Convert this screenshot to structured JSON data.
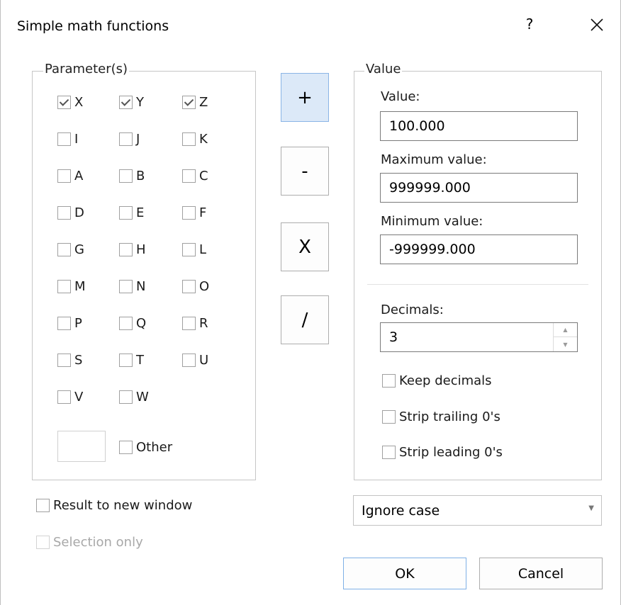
{
  "dialog": {
    "title": "Simple math functions",
    "help": "?"
  },
  "parameters": {
    "legend": "Parameter(s)",
    "checkboxes": [
      {
        "label": "X",
        "checked": true
      },
      {
        "label": "Y",
        "checked": true
      },
      {
        "label": "Z",
        "checked": true
      },
      {
        "label": "I",
        "checked": false
      },
      {
        "label": "J",
        "checked": false
      },
      {
        "label": "K",
        "checked": false
      },
      {
        "label": "A",
        "checked": false
      },
      {
        "label": "B",
        "checked": false
      },
      {
        "label": "C",
        "checked": false
      },
      {
        "label": "D",
        "checked": false
      },
      {
        "label": "E",
        "checked": false
      },
      {
        "label": "F",
        "checked": false
      },
      {
        "label": "G",
        "checked": false
      },
      {
        "label": "H",
        "checked": false
      },
      {
        "label": "L",
        "checked": false
      },
      {
        "label": "M",
        "checked": false
      },
      {
        "label": "N",
        "checked": false
      },
      {
        "label": "O",
        "checked": false
      },
      {
        "label": "P",
        "checked": false
      },
      {
        "label": "Q",
        "checked": false
      },
      {
        "label": "R",
        "checked": false
      },
      {
        "label": "S",
        "checked": false
      },
      {
        "label": "T",
        "checked": false
      },
      {
        "label": "U",
        "checked": false
      },
      {
        "label": "V",
        "checked": false
      },
      {
        "label": "W",
        "checked": false
      }
    ],
    "other_label": "Other"
  },
  "operations": {
    "add": "+",
    "subtract": "-",
    "multiply": "X",
    "divide": "/"
  },
  "value_group": {
    "legend": "Value",
    "value_label": "Value:",
    "value": "100.000",
    "max_label": "Maximum value:",
    "max": "999999.000",
    "min_label": "Minimum value:",
    "min": "-999999.000",
    "decimals_label": "Decimals:",
    "decimals": "3",
    "keep_decimals": "Keep decimals",
    "strip_trailing": "Strip trailing 0's",
    "strip_leading": "Strip leading 0's"
  },
  "options": {
    "result_new_window": "Result to new window",
    "selection_only": "Selection only"
  },
  "case_select": {
    "selected": "Ignore case"
  },
  "buttons": {
    "ok": "OK",
    "cancel": "Cancel"
  }
}
